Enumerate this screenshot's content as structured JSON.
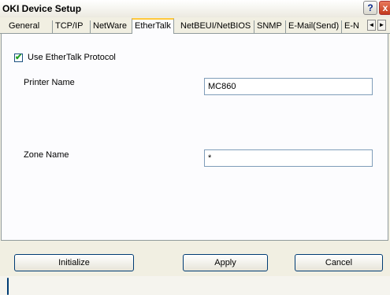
{
  "window": {
    "title": "OKI Device Setup",
    "help_icon": "?",
    "close_icon": "x"
  },
  "tabs": [
    {
      "label": "General"
    },
    {
      "label": "TCP/IP"
    },
    {
      "label": "NetWare"
    },
    {
      "label": "EtherTalk"
    },
    {
      "label": "NetBEUI/NetBIOS"
    },
    {
      "label": "SNMP"
    },
    {
      "label": "E-Mail(Send)"
    },
    {
      "label": "E-N"
    }
  ],
  "active_tab": "EtherTalk",
  "tab_scroll": {
    "left_icon": "◄",
    "right_icon": "►"
  },
  "ethertalk": {
    "use_protocol_label": "Use EtherTalk Protocol",
    "use_protocol_checked": true,
    "printer_name_label": "Printer Name",
    "printer_name_value": "MC860",
    "zone_name_label": "Zone Name",
    "zone_name_value": "*"
  },
  "buttons": {
    "initialize": "Initialize",
    "apply": "Apply",
    "cancel": "Cancel"
  },
  "colors": {
    "title_bg": "#ffffff",
    "active_tab_accent": "#ffc83c",
    "button_border": "#003c74",
    "checkmark": "#21a121"
  }
}
